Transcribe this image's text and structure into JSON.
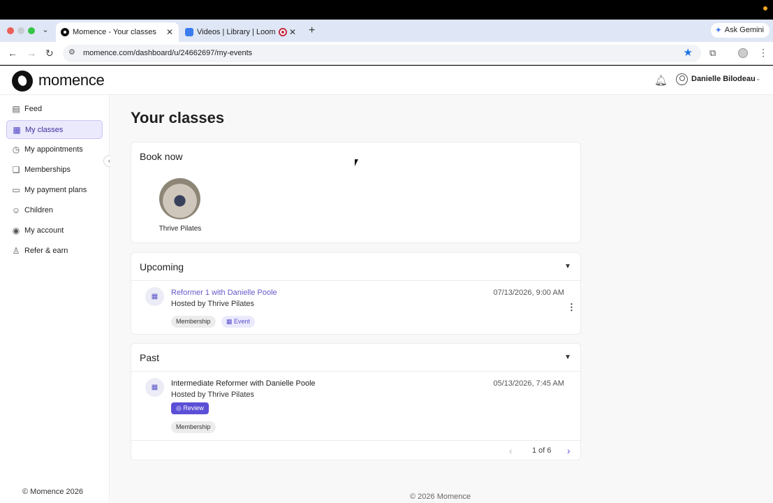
{
  "browser": {
    "tabs": [
      {
        "label": "Momence - Your classes",
        "close": "✕"
      },
      {
        "label": "Videos | Library | Loom",
        "close": ""
      },
      {
        "label": "",
        "close": "✕"
      }
    ],
    "new_tab": "+",
    "gemini_label": "Ask Gemini",
    "url": "momence.com/dashboard/u/24662697/my-events"
  },
  "app": {
    "brand": "momence",
    "user_name": "Danielle Bilodeau"
  },
  "sidebar": {
    "items": [
      {
        "label": "Feed",
        "icon": "doc-icon"
      },
      {
        "label": "My classes",
        "icon": "calendar-icon"
      },
      {
        "label": "My appointments",
        "icon": "clock-icon"
      },
      {
        "label": "Memberships",
        "icon": "membership-icon"
      },
      {
        "label": "My payment plans",
        "icon": "card-icon"
      },
      {
        "label": "Children",
        "icon": "child-icon"
      },
      {
        "label": "My account",
        "icon": "account-icon"
      },
      {
        "label": "Refer & earn",
        "icon": "refer-icon"
      }
    ],
    "footer": "© Momence 2026"
  },
  "main": {
    "title": "Your classes",
    "book_now": {
      "title": "Book now",
      "studios": [
        {
          "name": "Thrive Pilates"
        }
      ]
    },
    "upcoming": {
      "title": "Upcoming",
      "events": [
        {
          "title": "Reformer 1 with Danielle Poole",
          "host": "Hosted by Thrive Pilates",
          "datetime": "07/13/2026, 9:00 AM",
          "tags": [
            "Membership",
            "Event"
          ]
        }
      ]
    },
    "past": {
      "title": "Past",
      "events": [
        {
          "title": "Intermediate Reformer with Danielle Poole",
          "host": "Hosted by Thrive Pilates",
          "datetime": "05/13/2026, 7:45 AM",
          "review_label": "Review",
          "tags": [
            "Membership"
          ]
        }
      ],
      "pagination": "1 of 6"
    },
    "footer": "© 2026 Momence"
  },
  "colors": {
    "accent": "#5b4fd6",
    "link": "#6559c9",
    "active_bg": "#ebeafd"
  }
}
